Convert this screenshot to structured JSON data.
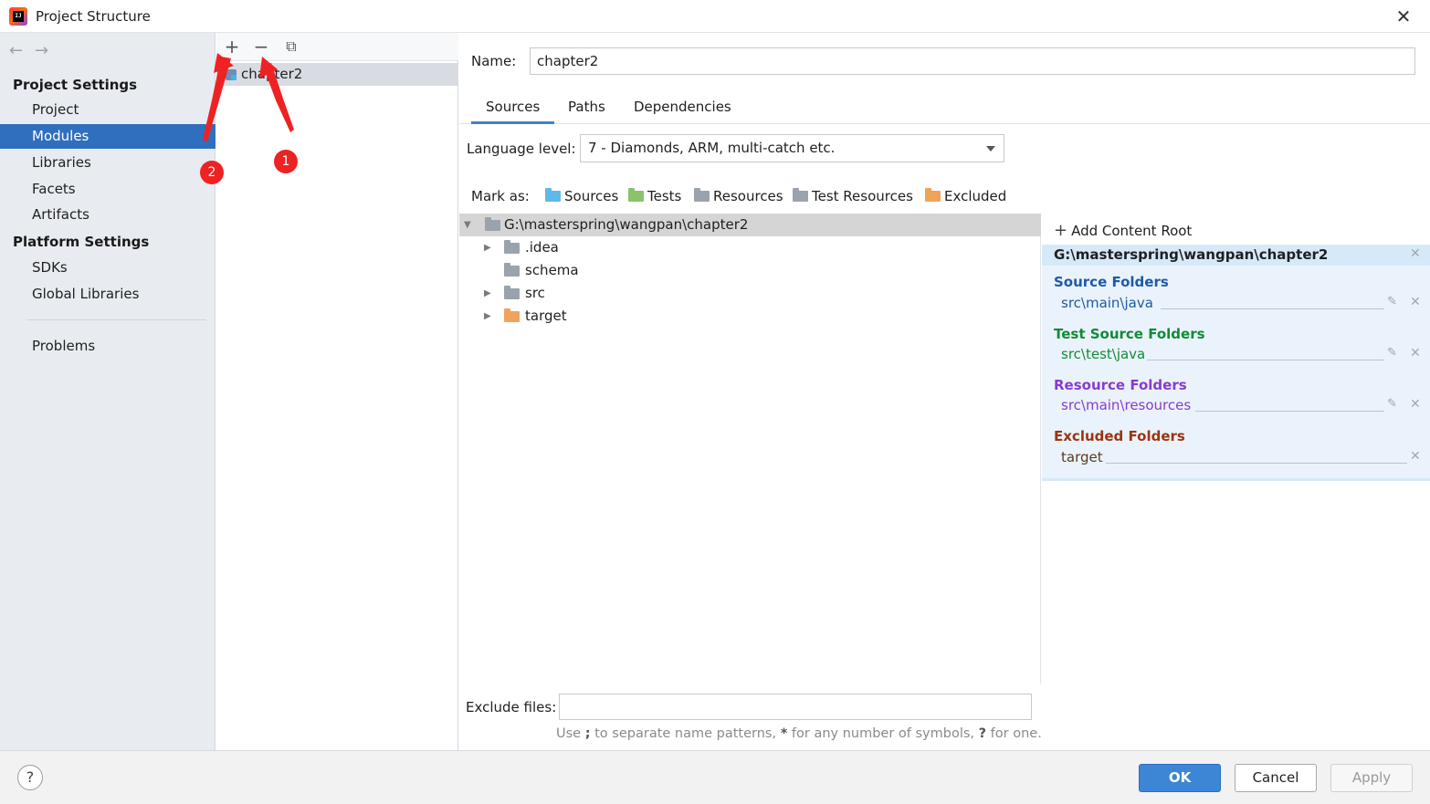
{
  "window": {
    "title": "Project Structure",
    "close_glyph": "✕"
  },
  "nav": {
    "back": "←",
    "forward": "→",
    "project_settings": "Project Settings",
    "project_items": [
      "Project",
      "Modules",
      "Libraries",
      "Facets",
      "Artifacts"
    ],
    "platform_settings": "Platform Settings",
    "platform_items": [
      "SDKs",
      "Global Libraries"
    ],
    "problems": "Problems",
    "selected": "Modules"
  },
  "module_list": {
    "toolbar": {
      "add": "+",
      "remove": "−",
      "copy": "⧉"
    },
    "modules": [
      "chapter2"
    ]
  },
  "module": {
    "name_label": "Name:",
    "name_value": "chapter2",
    "tabs": [
      "Sources",
      "Paths",
      "Dependencies"
    ],
    "active_tab": "Sources",
    "language_level_label": "Language level:",
    "language_level_value": "7 - Diamonds, ARM, multi-catch etc.",
    "mark_as_label": "Mark as:",
    "mark_as": [
      {
        "label": "Sources",
        "color": "#5fb9e8"
      },
      {
        "label": "Tests",
        "color": "#8ac36a"
      },
      {
        "label": "Resources",
        "color": "#9aa3ad"
      },
      {
        "label": "Test Resources",
        "color": "#9aa3ad"
      },
      {
        "label": "Excluded",
        "color": "#f0a35a"
      }
    ]
  },
  "tree": {
    "root": "G:\\masterspring\\wangpan\\chapter2",
    "children": [
      {
        "label": ".idea",
        "expandable": true,
        "color": "#9aa3ad"
      },
      {
        "label": "schema",
        "expandable": false,
        "color": "#9aa3ad"
      },
      {
        "label": "src",
        "expandable": true,
        "color": "#9aa3ad"
      },
      {
        "label": "target",
        "expandable": true,
        "color": "#f0a35a"
      }
    ]
  },
  "content_root": {
    "add_label": "Add Content Root",
    "path": "G:\\masterspring\\wangpan\\chapter2",
    "groups": [
      {
        "title": "Source Folders",
        "path": "src\\main\\java",
        "color": "#1f5aa6"
      },
      {
        "title": "Test Source Folders",
        "path": "src\\test\\java",
        "color": "#138a36"
      },
      {
        "title": "Resource Folders",
        "path": "src\\main\\resources",
        "color": "#8a3ad1"
      },
      {
        "title": "Excluded Folders",
        "path": "target",
        "color": "#9a3412"
      }
    ]
  },
  "exclude": {
    "label": "Exclude files:",
    "value": "",
    "hint_parts": [
      "Use ",
      ";",
      " to separate name patterns, ",
      "*",
      " for any number of symbols, ",
      "?",
      " for one."
    ]
  },
  "buttons": {
    "help": "?",
    "ok": "OK",
    "cancel": "Cancel",
    "apply": "Apply"
  },
  "annotations": [
    "1",
    "2"
  ],
  "colors": {
    "selection": "#2f6fbd",
    "annotation_red": "#ee2222",
    "ok_button": "#3d86d6"
  }
}
